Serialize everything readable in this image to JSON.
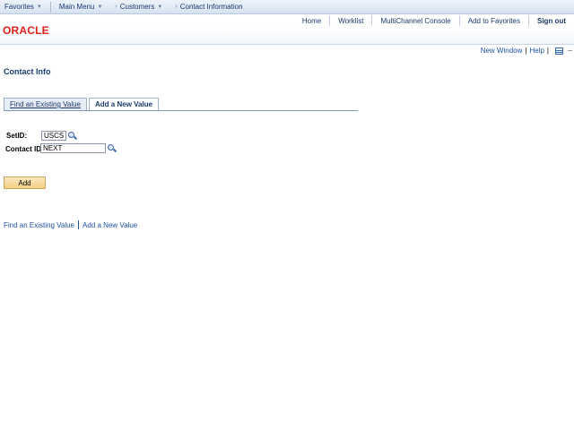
{
  "menubar": {
    "favorites": "Favorites",
    "main_menu": "Main Menu",
    "breadcrumbs": [
      "Customers",
      "Contact Information"
    ]
  },
  "header": {
    "logo": "ORACLE",
    "links": {
      "home": "Home",
      "worklist": "Worklist",
      "multichannel": "MultiChannel Console",
      "add_favorites": "Add to Favorites",
      "sign_out": "Sign out"
    }
  },
  "utility": {
    "new_window": "New Window",
    "help": "Help"
  },
  "page": {
    "title": "Contact Info"
  },
  "tabs": {
    "find_existing": "Find an Existing Value",
    "add_new": "Add a New Value"
  },
  "form": {
    "setid_label": "SetID:",
    "setid_value": "USCSP",
    "contact_id_label": "Contact ID:",
    "contact_id_value": "NEXT",
    "add_button": "Add"
  },
  "bottom_links": {
    "find_existing": "Find an Existing Value",
    "add_new": "Add a New Value"
  }
}
